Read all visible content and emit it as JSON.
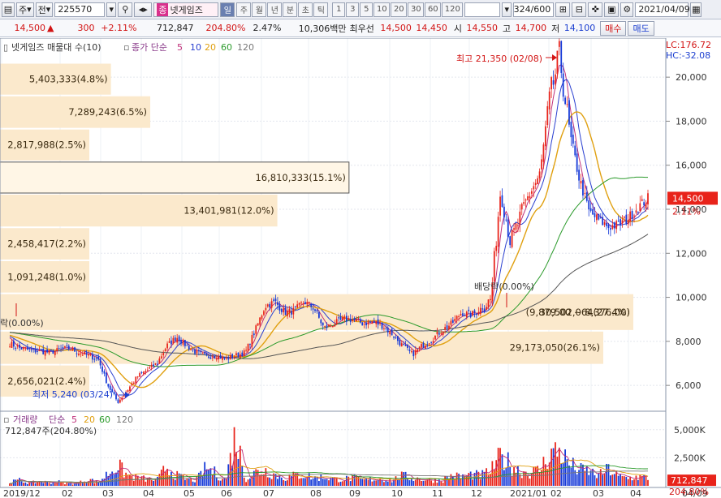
{
  "toolbar": {
    "market": "주",
    "view": "전",
    "code": "225570",
    "name_tag": "종",
    "name": "넷게임즈",
    "period_sel": "일",
    "periods": [
      "주",
      "월",
      "년",
      "분",
      "초",
      "틱"
    ],
    "numbers": [
      "1",
      "3",
      "5",
      "10",
      "20",
      "30",
      "60",
      "120"
    ],
    "count": "324/600",
    "date": "2021/04/09"
  },
  "info": {
    "price": "14,500",
    "change": "300",
    "pct": "+2.11%",
    "volume": "712,847",
    "vol_ratio": "204.80%",
    "vol_pct": "2.47%",
    "amount": "10,306백만",
    "best_label": "최우선",
    "ask": "14,500",
    "bid": "14,450",
    "open_label": "시",
    "open": "14,550",
    "high_label": "고",
    "high": "14,700",
    "low_label": "저",
    "low": "14,100",
    "buy": "매수",
    "sell": "매도"
  },
  "price_panel": {
    "legend_name": "넷게임즈 매물대 수(10)",
    "ma_label": "종가 단순",
    "ma_periods": [
      "5",
      "10",
      "20",
      "60",
      "120"
    ],
    "lc": "LC:176.72",
    "hc": "HC:-32.08",
    "y_ticks": [
      "20,000",
      "18,000",
      "16,000",
      "14,000",
      "12,000",
      "10,000",
      "8,000",
      "6,000"
    ],
    "cur_price": "14,500",
    "cur_pct": "2.11%",
    "high_note": "최고 21,350 (02/08)",
    "low_note": "최저 5,240 (03/24)",
    "div_note": "배당락(0.00%)",
    "div_note_left": "락(0.00%)"
  },
  "volume_panel": {
    "legend": "거래량",
    "ma_label": "단순",
    "ma_periods": [
      "5",
      "20",
      "60",
      "120"
    ],
    "cur_label": "712,847주(204.80%)",
    "y_ticks": [
      "5,000K",
      "2,500K"
    ],
    "cur_vol": "712,847",
    "cur_ratio": "204.80%"
  },
  "x_labels": [
    "2019/12",
    "02",
    "03",
    "04",
    "05",
    "06",
    "07",
    "08",
    "09",
    "10",
    "11",
    "12",
    "2021/01",
    "02",
    "03",
    "04",
    "04/09"
  ],
  "chart_data": {
    "type": "candlestick",
    "title": "넷게임즈",
    "ylim": [
      4900,
      21700
    ],
    "vlim": [
      0,
      6500000
    ],
    "volume_profile": [
      {
        "value": "5,403,333(4.8%)",
        "pct": 4.8
      },
      {
        "value": "7,289,243(6.5%)",
        "pct": 6.5
      },
      {
        "value": "2,817,988(2.5%)",
        "pct": 2.5
      },
      {
        "value": "16,810,333(15.1%)",
        "pct": 15.1
      },
      {
        "value": "13,401,981(12.0%)",
        "pct": 12.0
      },
      {
        "value": "2,458,417(2.2%)",
        "pct": 2.2
      },
      {
        "value": "1,091,248(1.0%)",
        "pct": 1.0
      },
      {
        "value": "30,502,064(27.4%)",
        "pct": 27.4
      },
      {
        "value": "29,173,050(26.1%)",
        "pct": 26.1
      },
      {
        "value": "2,656,021(2.4%)",
        "pct": 2.4
      }
    ],
    "peak_range": "9,879.00 ~ 8,376.00",
    "close_path": [
      7900,
      7700,
      7600,
      7550,
      7500,
      7600,
      7700,
      7500,
      7350,
      7200,
      6000,
      5240,
      5800,
      6400,
      6700,
      7000,
      7800,
      8200,
      7800,
      7500,
      7300,
      7350,
      7200,
      7350,
      7500,
      8500,
      9600,
      9800,
      9300,
      9400,
      9800,
      9500,
      8600,
      8800,
      9000,
      9000,
      8800,
      8900,
      8700,
      8300,
      7800,
      7400,
      7800,
      8100,
      8500,
      8800,
      9300,
      9200,
      9500,
      9900,
      15000,
      12500,
      13600,
      14800,
      15500,
      19000,
      21000,
      17500,
      15400,
      13900,
      13500,
      13200,
      13300,
      13600,
      14100,
      14500
    ],
    "volume_path": [
      300,
      500,
      250,
      400,
      300,
      350,
      200,
      250,
      600,
      300,
      1100,
      1800,
      900,
      700,
      600,
      500,
      1700,
      900,
      600,
      500,
      1600,
      1100,
      500,
      4600,
      600,
      1200,
      1400,
      1000,
      700,
      900,
      1000,
      700,
      800,
      600,
      600,
      700,
      500,
      600,
      600,
      500,
      900,
      700,
      600,
      500,
      500,
      900,
      800,
      1000,
      900,
      1300,
      2600,
      1900,
      1300,
      1200,
      1400,
      2900,
      3100,
      1900,
      1400,
      1300,
      900,
      1500,
      800,
      700,
      800,
      713
    ]
  }
}
